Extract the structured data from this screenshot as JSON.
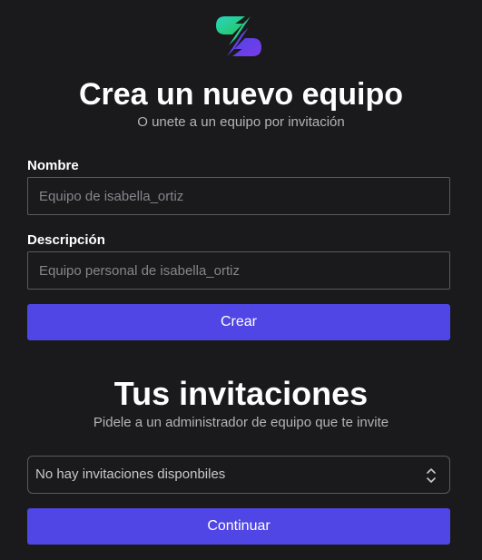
{
  "create_team": {
    "title": "Crea un nuevo equipo",
    "subtitle": "O unete a un equipo por invitación",
    "name_label": "Nombre",
    "name_placeholder": "Equipo de isabella_ortiz",
    "description_label": "Descripción",
    "description_placeholder": "Equipo personal de isabella_ortiz",
    "create_button": "Crear"
  },
  "invitations": {
    "title": "Tus invitaciones",
    "subtitle": "Pidele a un administrador de equipo que te invite",
    "select_value": "No hay invitaciones disponbiles",
    "continue_button": "Continuar"
  },
  "colors": {
    "background": "#1a191c",
    "accent": "#4f46e5",
    "logo_gradient": [
      "#2dd4bf",
      "#7c3aed"
    ]
  },
  "icons": {
    "logo": "brand-logo-icon",
    "select_toggle": "chevron-up-down-icon"
  }
}
